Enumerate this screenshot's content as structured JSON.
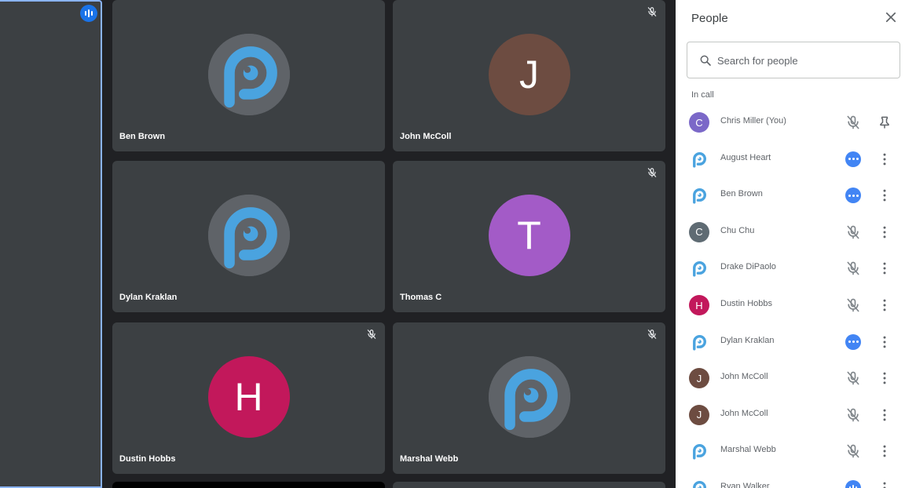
{
  "grid": {
    "tiles": [
      {
        "name": "Ben Brown",
        "avatar_type": "logo",
        "muted": false
      },
      {
        "name": "John McColl",
        "avatar_type": "letter",
        "letter": "J",
        "color": "#6d4c41",
        "muted": true
      },
      {
        "name": "Dylan Kraklan",
        "avatar_type": "logo",
        "muted": false
      },
      {
        "name": "Thomas C",
        "avatar_type": "letter",
        "letter": "T",
        "color": "#a35bc7",
        "muted": true
      },
      {
        "name": "Dustin Hobbs",
        "avatar_type": "letter",
        "letter": "H",
        "color": "#c2185b",
        "muted": true
      },
      {
        "name": "Marshal Webb",
        "avatar_type": "logo",
        "muted": true
      }
    ]
  },
  "panel": {
    "title": "People",
    "search_placeholder": "Search for people",
    "section_label": "In call",
    "people": [
      {
        "name": "Chris Miller (You)",
        "avatar_type": "letter",
        "letter": "C",
        "color": "#7b68c8",
        "action": "mic-off",
        "secondary": "pin"
      },
      {
        "name": "August Heart",
        "avatar_type": "logo",
        "action": "dots",
        "secondary": "more"
      },
      {
        "name": "Ben Brown",
        "avatar_type": "logo",
        "action": "dots",
        "secondary": "more"
      },
      {
        "name": "Chu Chu",
        "avatar_type": "letter",
        "letter": "C",
        "color": "#5f6b73",
        "action": "mic-off",
        "secondary": "more"
      },
      {
        "name": "Drake DiPaolo",
        "avatar_type": "logo",
        "action": "mic-off",
        "secondary": "more"
      },
      {
        "name": "Dustin Hobbs",
        "avatar_type": "letter",
        "letter": "H",
        "color": "#c2185b",
        "action": "mic-off",
        "secondary": "more"
      },
      {
        "name": "Dylan Kraklan",
        "avatar_type": "logo",
        "action": "dots",
        "secondary": "more"
      },
      {
        "name": "John McColl",
        "avatar_type": "letter",
        "letter": "J",
        "color": "#6d4c41",
        "action": "mic-off",
        "secondary": "more"
      },
      {
        "name": "John McColl",
        "avatar_type": "letter",
        "letter": "J",
        "color": "#6d4c41",
        "action": "mic-off",
        "secondary": "more"
      },
      {
        "name": "Marshal Webb",
        "avatar_type": "logo",
        "action": "mic-off",
        "secondary": "more"
      },
      {
        "name": "Ryan Walker",
        "avatar_type": "logo",
        "action": "speaking",
        "secondary": "more"
      }
    ]
  },
  "colors": {
    "accent": "#4285f4",
    "logo": "#4aa3df",
    "tile": "#3c4043"
  }
}
